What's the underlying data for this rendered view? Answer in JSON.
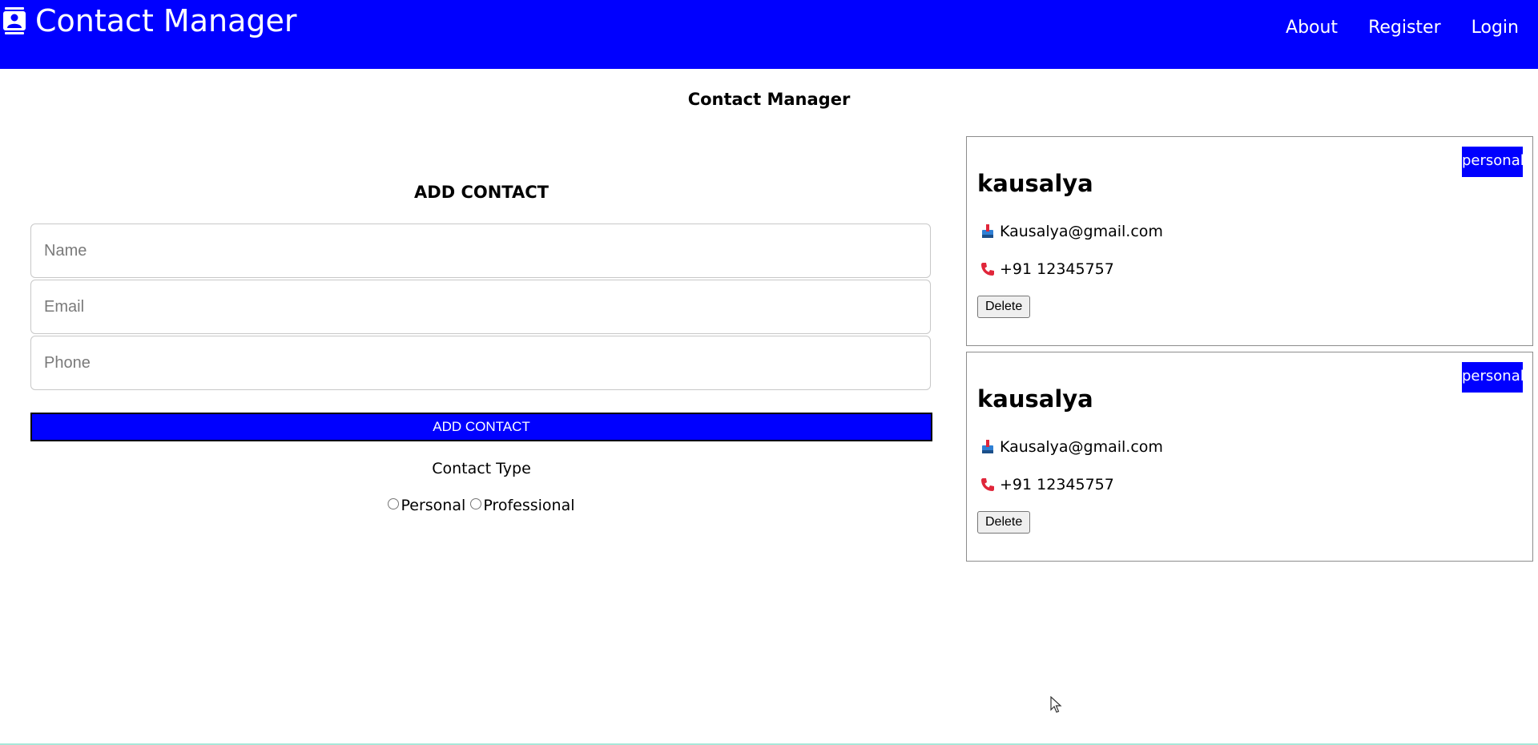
{
  "navbar": {
    "brand": "Contact Manager",
    "brand_icon": "contact-book-icon",
    "links": [
      "About",
      "Register",
      "Login"
    ]
  },
  "page_title": "Contact Manager",
  "form": {
    "title": "ADD CONTACT",
    "name_placeholder": "Name",
    "email_placeholder": "Email",
    "phone_placeholder": "Phone",
    "submit_label": "ADD CONTACT",
    "type_label": "Contact Type",
    "options": [
      "Personal",
      "Professional"
    ]
  },
  "contacts": [
    {
      "name": "kausalya",
      "email": "Kausalya@gmail.com",
      "phone": "+91 12345757",
      "type": "personal",
      "delete_label": "Delete"
    },
    {
      "name": "kausalya",
      "email": "Kausalya@gmail.com",
      "phone": "+91 12345757",
      "type": "personal",
      "delete_label": "Delete"
    }
  ],
  "colors": {
    "primary": "#0000ff",
    "phone_icon": "#e0263a",
    "mail_icon": "#2f7fd4"
  }
}
